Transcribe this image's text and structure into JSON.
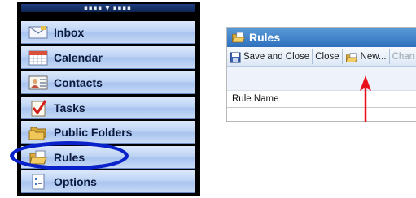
{
  "nav": {
    "grip": "▪▪▪▪ ▼ ▪▪▪▪",
    "items": [
      {
        "label": "Inbox",
        "icon": "envelope-icon"
      },
      {
        "label": "Calendar",
        "icon": "calendar-icon"
      },
      {
        "label": "Contacts",
        "icon": "contact-card-icon"
      },
      {
        "label": "Tasks",
        "icon": "clipboard-check-icon"
      },
      {
        "label": "Public Folders",
        "icon": "folder-stack-icon"
      },
      {
        "label": "Rules",
        "icon": "open-folder-envelope-icon"
      },
      {
        "label": "Options",
        "icon": "options-document-icon"
      }
    ]
  },
  "rules_window": {
    "title": "Rules",
    "toolbar": {
      "save_close": "Save and Close",
      "close": "Close",
      "new": "New...",
      "change": "Chan"
    },
    "column_header": "Rule Name"
  },
  "colors": {
    "highlight": "#0a22c9",
    "arrow": "#e8101a",
    "title_bar": "#2e70bd"
  }
}
